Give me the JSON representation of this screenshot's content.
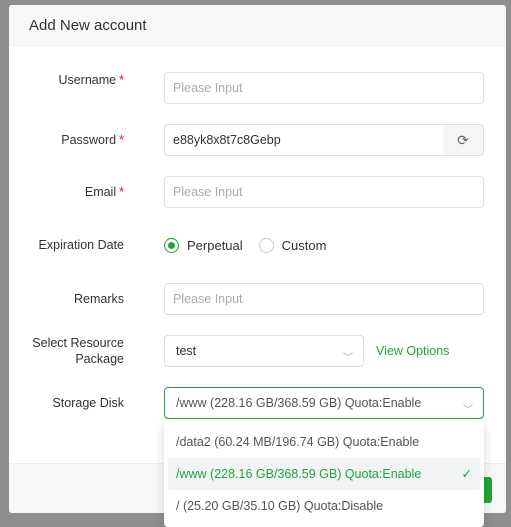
{
  "title": "Add New account",
  "form": {
    "username": {
      "label": "Username",
      "placeholder": "Please Input",
      "required": "*"
    },
    "password": {
      "label": "Password",
      "value": "e88yk8x8t7c8Gebp",
      "required": "*",
      "refresh_icon": "refresh-icon"
    },
    "email": {
      "label": "Email",
      "placeholder": "Please Input",
      "required": "*"
    },
    "expiration": {
      "label": "Expiration Date",
      "options": [
        "Perpetual",
        "Custom"
      ],
      "selected": "Perpetual"
    },
    "remarks": {
      "label": "Remarks",
      "placeholder": "Please Input"
    },
    "package": {
      "label": "Select Resource Package",
      "value": "test",
      "view_options": "View Options"
    },
    "disk": {
      "label": "Storage Disk",
      "value": "/www (228.16 GB/368.59 GB) Quota:Enable",
      "options": [
        "/data2 (60.24 MB/196.74 GB) Quota:Enable",
        "/www (228.16 GB/368.59 GB) Quota:Enable",
        "/ (25.20 GB/35.10 GB) Quota:Disable"
      ]
    }
  },
  "colors": {
    "accent": "#20a53a",
    "required": "#ff0033"
  }
}
